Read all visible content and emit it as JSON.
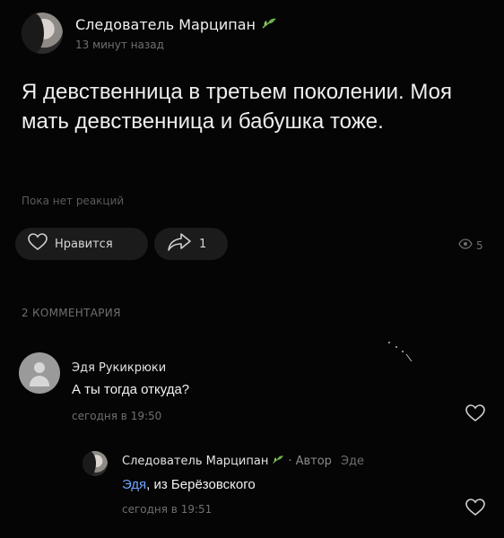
{
  "post": {
    "author": "Следователь Марципан",
    "time": "13 минут назад",
    "text": "Я девственница в третьем поколении. Моя мать девственница и бабушка тоже.",
    "reactions_text": "Пока нет реакций",
    "like_label": "Нравится",
    "share_count": "1",
    "views": "5"
  },
  "comments_header": "2 КОММЕНТАРИЯ",
  "comments": [
    {
      "author": "Эдя Рукикрюки",
      "text": "А ты тогда откуда?",
      "time": "сегодня в 19:50"
    },
    {
      "author": "Следователь Марципан",
      "author_badge": "· Автор",
      "reply_to": "Эде",
      "mention": "Эдя",
      "text": ", из Берёзовского",
      "time": "сегодня в 19:51"
    }
  ],
  "colors": {
    "background": "#050505",
    "mention": "#6ea3ff",
    "leaf": "#6fb24a"
  },
  "icons": [
    "leaf-icon",
    "heart-icon",
    "share-icon",
    "eye-icon",
    "avatar-placeholder-icon"
  ]
}
